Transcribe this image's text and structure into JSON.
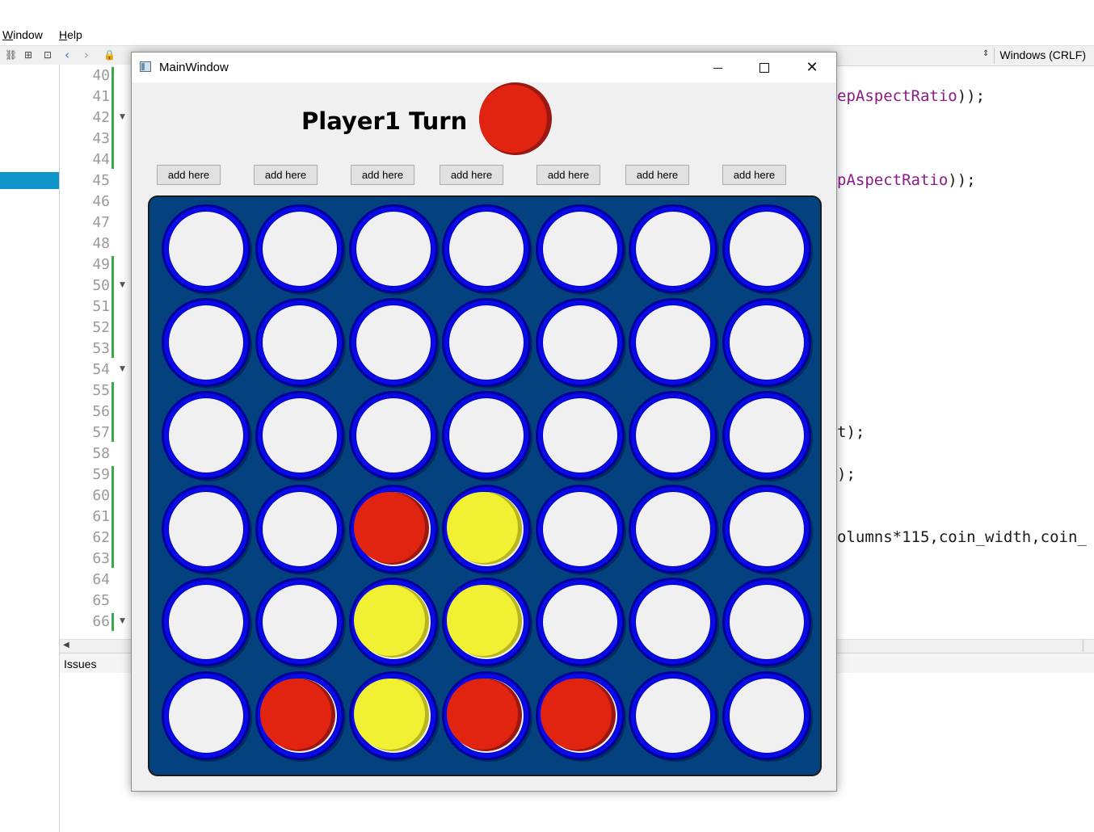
{
  "ide": {
    "menu": [
      {
        "first": "W",
        "rest": "indow"
      },
      {
        "first": "H",
        "rest": "elp"
      }
    ],
    "encoding": "Windows (CRLF)",
    "line_numbers": [
      "40",
      "41",
      "42",
      "43",
      "44",
      "45",
      "46",
      "47",
      "48",
      "49",
      "50",
      "51",
      "52",
      "53",
      "54",
      "55",
      "56",
      "57",
      "58",
      "59",
      "60",
      "61",
      "62",
      "63",
      "64",
      "65",
      "66"
    ],
    "code_fragments": [
      {
        "pre": "",
        "kw": "epAspectRatio",
        "post": "));"
      },
      {
        "pre": "",
        "kw": "pAspectRatio",
        "post": "));"
      },
      {
        "pre": "t);",
        "kw": "",
        "post": ""
      },
      {
        "pre": ");",
        "kw": "",
        "post": ""
      },
      {
        "pre": "olumns*115,coin_width,coin_",
        "kw": "",
        "post": ""
      }
    ],
    "issues_label": "Issues"
  },
  "window": {
    "title": "MainWindow",
    "turn_text": "Player1 Turn",
    "turn_player_color": "red",
    "add_buttons": [
      "add here",
      "add here",
      "add here",
      "add here",
      "add here",
      "add here",
      "add here"
    ],
    "board": {
      "rows": 6,
      "columns": 7,
      "cells": [
        [
          "empty",
          "empty",
          "empty",
          "empty",
          "empty",
          "empty",
          "empty"
        ],
        [
          "empty",
          "empty",
          "empty",
          "empty",
          "empty",
          "empty",
          "empty"
        ],
        [
          "empty",
          "empty",
          "empty",
          "empty",
          "empty",
          "empty",
          "empty"
        ],
        [
          "empty",
          "empty",
          "red",
          "yellow",
          "empty",
          "empty",
          "empty"
        ],
        [
          "empty",
          "empty",
          "yellow",
          "yellow",
          "empty",
          "empty",
          "empty"
        ],
        [
          "empty",
          "red",
          "yellow",
          "red",
          "red",
          "empty",
          "empty"
        ]
      ]
    }
  },
  "colors": {
    "board": "#03427e",
    "ring": "#0a0ae8",
    "empty": "#f0f0f0",
    "red": "#e0240f",
    "red_shade": "#9a1712",
    "yellow": "#f2f032",
    "yellow_shade": "#b8b61e",
    "selection": "#0f93c9"
  }
}
